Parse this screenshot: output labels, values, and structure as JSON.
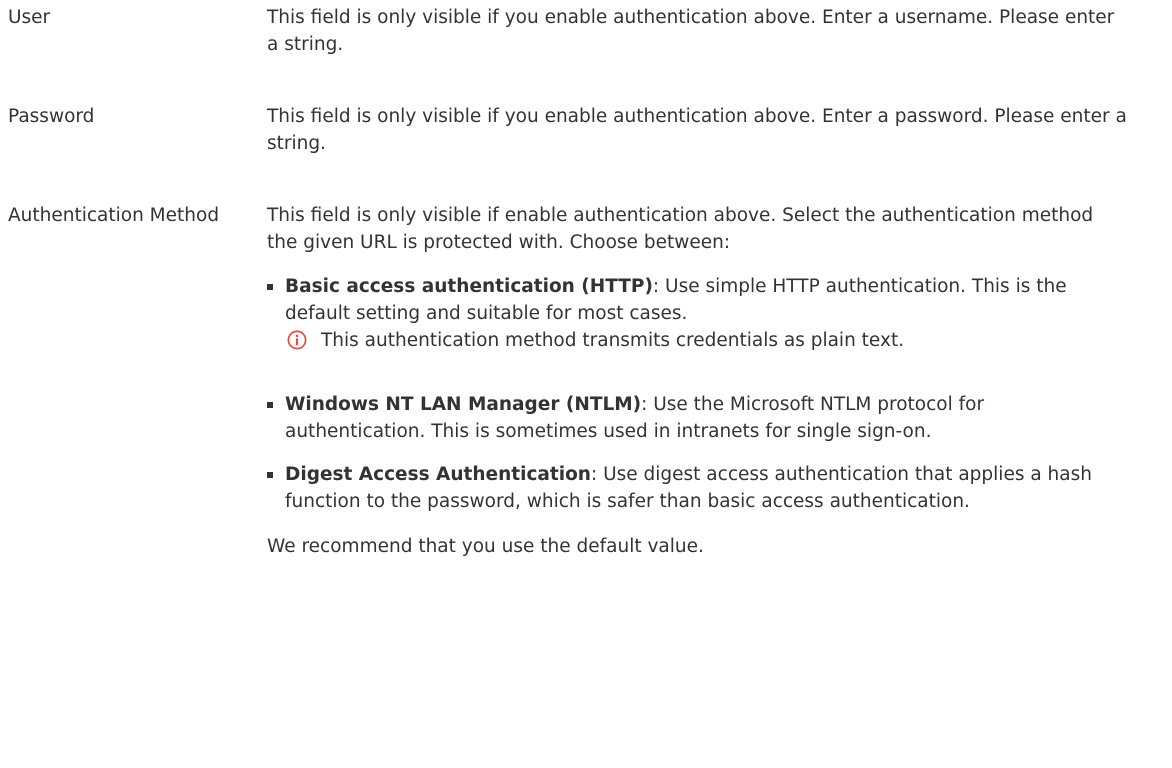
{
  "fields": [
    {
      "label": "User",
      "description": "This field is only visible if you enable authentication above. Enter a username. Please enter a string."
    },
    {
      "label": "Password",
      "description": "This field is only visible if you enable authentication above. Enter a password. Please enter a string."
    }
  ],
  "auth_method": {
    "label": "Authentication Method",
    "intro": "This field is only visible if enable authentication above. Select the authentication method the given URL is protected with. Choose between:",
    "options": [
      {
        "name": "Basic access authentication (HTTP)",
        "text": ": Use simple HTTP authentication. This is the default setting and suitable for most cases.",
        "note": "This authentication method transmits credentials as plain text."
      },
      {
        "name": "Windows NT LAN Manager (NTLM)",
        "text": ": Use the Microsoft NTLM protocol for authentication. This is sometimes used in intranets for single sign-on."
      },
      {
        "name": "Digest Access Authentication",
        "text": ": Use digest access authentication that applies a hash function to the password, which is safer than basic access authentication."
      }
    ],
    "recommendation": "We recommend that you use the default value."
  },
  "colors": {
    "text": "#333333",
    "info_icon": "#e8493f"
  },
  "icons": {
    "note": "info-icon"
  }
}
